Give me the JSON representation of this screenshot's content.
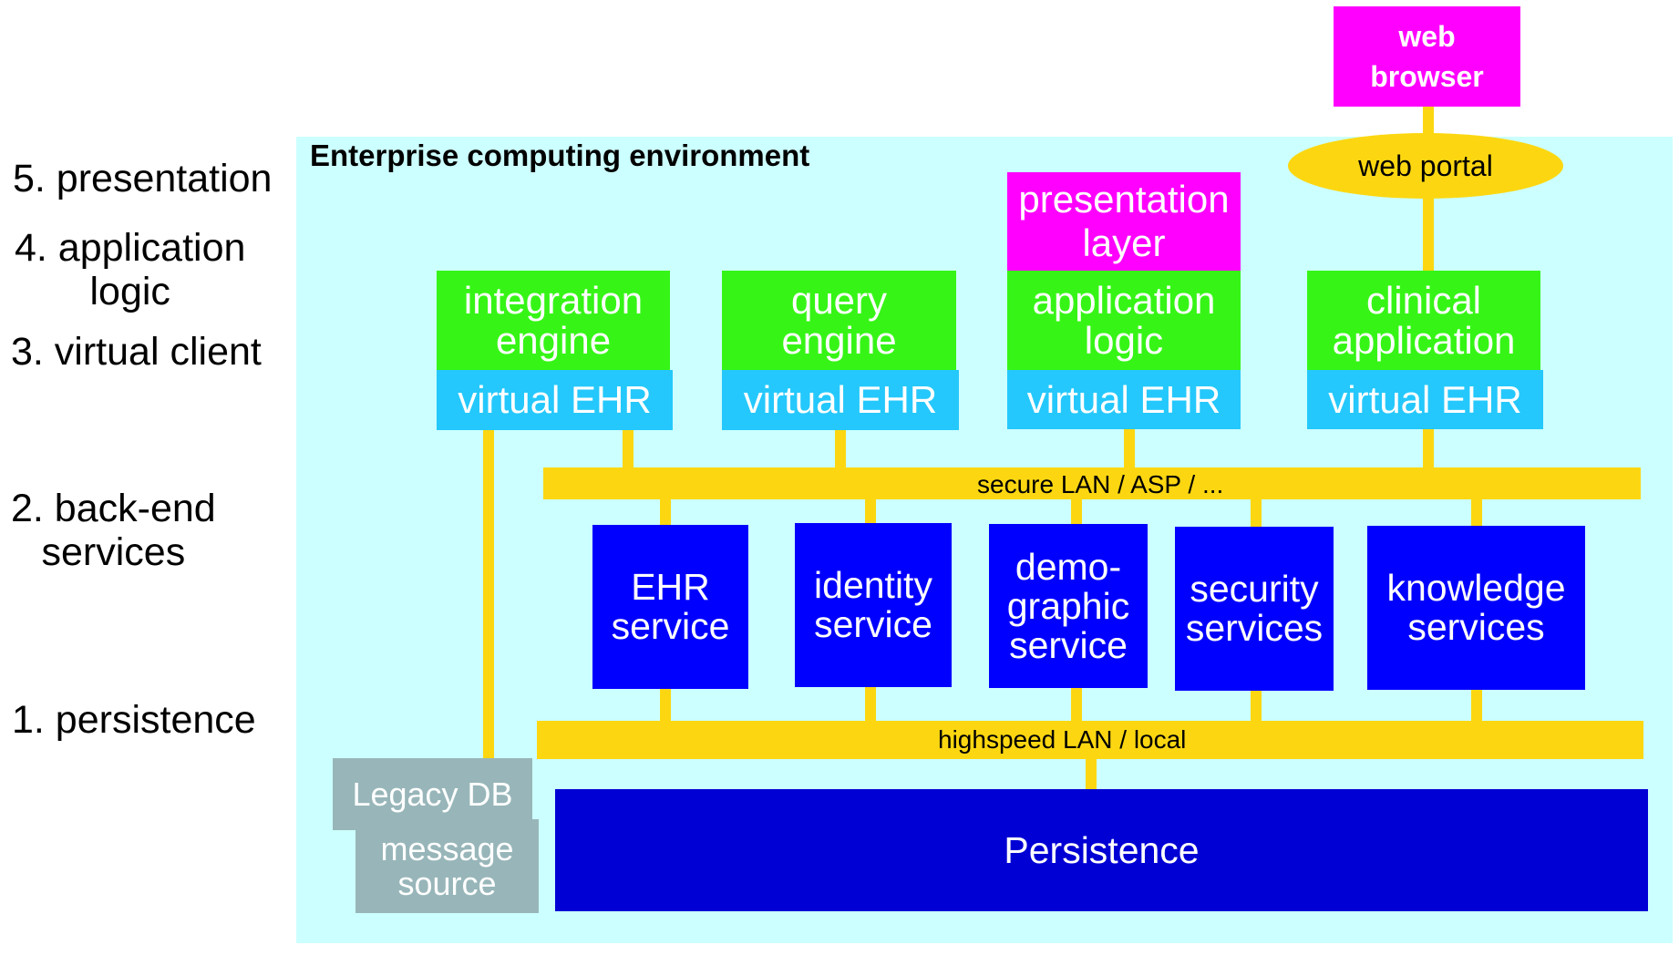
{
  "layers": [
    {
      "id": "presentation",
      "lines": [
        "5. presentation"
      ]
    },
    {
      "id": "application-logic",
      "lines": [
        "4. application",
        "logic"
      ]
    },
    {
      "id": "virtual-client",
      "lines": [
        "3. virtual client"
      ]
    },
    {
      "id": "back-end-services",
      "lines": [
        "2. back-end",
        "services"
      ]
    },
    {
      "id": "persistence",
      "lines": [
        "1. persistence"
      ]
    }
  ],
  "environment": {
    "title": "Enterprise computing environment"
  },
  "web_browser": {
    "lines": [
      "web",
      "browser"
    ]
  },
  "web_portal": {
    "label": "web portal"
  },
  "presentation_layer": {
    "lines": [
      "presentation",
      "layer"
    ]
  },
  "clients": [
    {
      "app": [
        "integration",
        "engine"
      ],
      "vehr": "virtual EHR"
    },
    {
      "app": [
        "query",
        "engine"
      ],
      "vehr": "virtual EHR"
    },
    {
      "app": [
        "application",
        "logic"
      ],
      "vehr": "virtual EHR"
    },
    {
      "app": [
        "clinical",
        "application"
      ],
      "vehr": "virtual EHR"
    }
  ],
  "secure_bus": {
    "label": "secure LAN / ASP / ..."
  },
  "services": [
    {
      "lines": [
        "EHR",
        "service"
      ]
    },
    {
      "lines": [
        "identity",
        "service"
      ]
    },
    {
      "lines": [
        "demo-",
        "graphic",
        "service"
      ]
    },
    {
      "lines": [
        "security",
        "services"
      ]
    },
    {
      "lines": [
        "knowledge",
        "services"
      ]
    }
  ],
  "local_bus": {
    "label": "highspeed LAN / local"
  },
  "persistence_store": {
    "label": "Persistence"
  },
  "legacy_db": {
    "label": "Legacy DB"
  },
  "message_source": {
    "lines": [
      "message",
      "source"
    ]
  },
  "colors": {
    "environment": "#ccffff",
    "bus": "#fcd711",
    "app_logic": "#36f516",
    "virtual_ehr": "#24c8fc",
    "presentation": "#ff00ff",
    "service": "#0000ff",
    "persistence": "#0000d4",
    "legacy": "#98b6b9"
  }
}
